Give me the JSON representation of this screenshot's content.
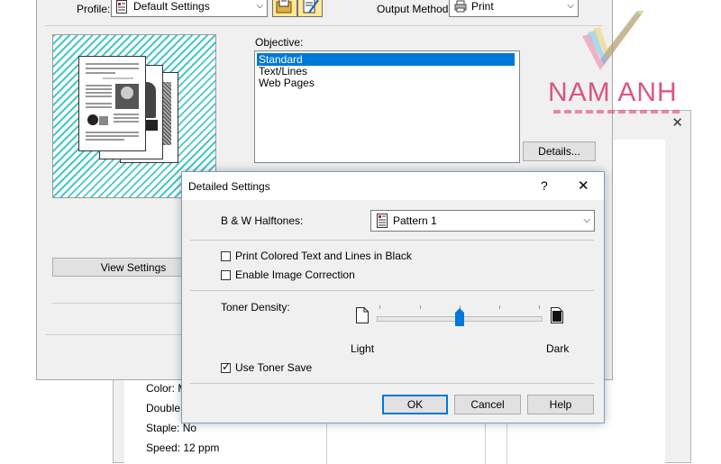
{
  "background_window": {
    "summary": [
      "Color: M",
      "Double",
      "Staple: No",
      "Speed: 12 ppm"
    ]
  },
  "main_window": {
    "profile_label": "Profile:",
    "profile_value": "Default Settings",
    "output_method_label": "Output Method:",
    "output_method_value": "Print",
    "objective_label": "Objective:",
    "objective_items": [
      "Standard",
      "Text/Lines",
      "Web Pages"
    ],
    "objective_selected": "Standard",
    "details_button": "Details...",
    "view_settings_button": "View Settings"
  },
  "dialog": {
    "title": "Detailed Settings",
    "help_glyph": "?",
    "close_glyph": "✕",
    "bw_halftones_label": "B & W Halftones:",
    "bw_halftones_value": "Pattern 1",
    "print_colored_black_label": "Print Colored Text and Lines in Black",
    "print_colored_black_checked": false,
    "enable_image_correction_label": "Enable Image Correction",
    "enable_image_correction_checked": false,
    "toner_density_label": "Toner Density:",
    "toner_density_min_label": "Light",
    "toner_density_max_label": "Dark",
    "toner_density_level": 0.5,
    "use_toner_save_label": "Use Toner Save",
    "use_toner_save_checked": true,
    "ok_button": "OK",
    "cancel_button": "Cancel",
    "help_button": "Help"
  },
  "watermark": {
    "text": "NAM ANH",
    "colors": [
      "#e8407a",
      "#2ab0e0",
      "#f0c020"
    ]
  },
  "colors": {
    "accent": "#0078d7",
    "watermark_text": "#d23a6e",
    "preview_hatch": "#48c8c8"
  }
}
